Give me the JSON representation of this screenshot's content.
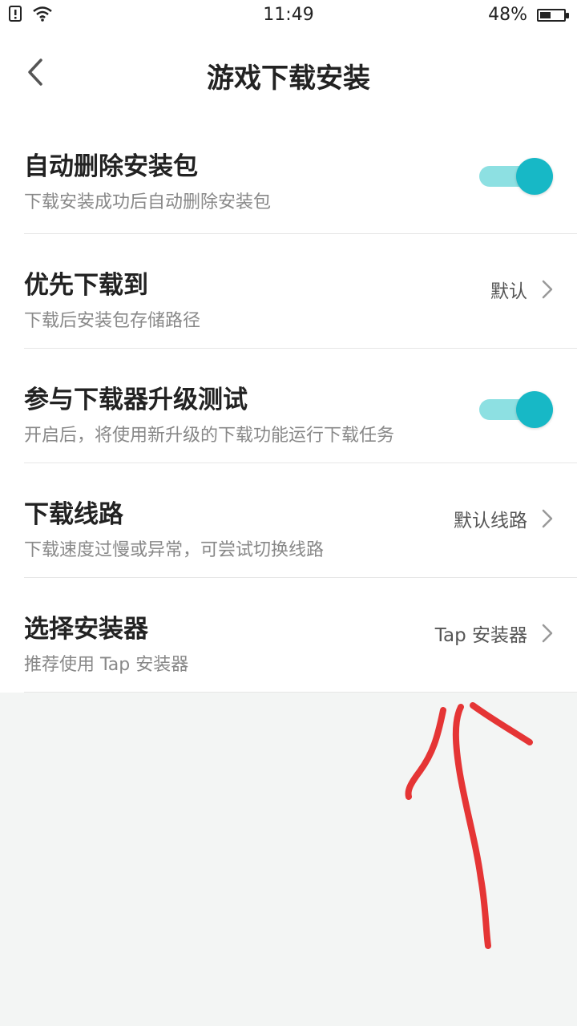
{
  "status_bar": {
    "time": "11:49",
    "battery_percent": "48%",
    "battery_level": 0.48,
    "icons": [
      "notification-alert-icon",
      "wifi-icon",
      "battery-icon"
    ]
  },
  "header": {
    "title": "游戏下载安装",
    "back_icon": "chevron-left-icon"
  },
  "settings": {
    "items": [
      {
        "title": "自动删除安装包",
        "subtitle": "下载安装成功后自动删除安装包",
        "control": "toggle",
        "enabled": true
      },
      {
        "title": "优先下载到",
        "subtitle": "下载后安装包存储路径",
        "control": "value",
        "value": "默认"
      },
      {
        "title": "参与下载器升级测试",
        "subtitle": "开启后，将使用新升级的下载功能运行下载任务",
        "control": "toggle",
        "enabled": true
      },
      {
        "title": "下载线路",
        "subtitle": "下载速度过慢或异常，可尝试切换线路",
        "control": "value",
        "value": "默认线路"
      },
      {
        "title": "选择安装器",
        "subtitle": "推荐使用 Tap 安装器",
        "control": "value",
        "value": "Tap 安装器"
      }
    ]
  },
  "colors": {
    "toggle_knob": "#17b8c6",
    "toggle_track": "#8de0e2",
    "annotation_stroke": "#e53535",
    "page_background": "#f3f5f4"
  }
}
